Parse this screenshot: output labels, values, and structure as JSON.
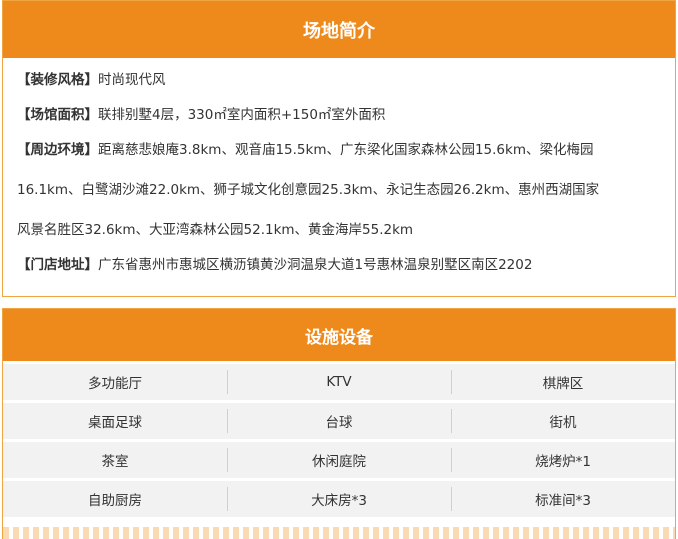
{
  "intro": {
    "title": "场地简介",
    "decor": {
      "label": "【装修风格】",
      "value": "时尚现代风"
    },
    "area": {
      "label": "【场馆面积】",
      "value": "联排别墅4层，330㎡室内面积+150㎡室外面积"
    },
    "env": {
      "label": "【周边环境】",
      "line1": "距离慈悲娘庵3.8km、观音庙15.5km、广东梁化国家森林公园15.6km、梁化梅园",
      "line2": "16.1km、白鹭湖沙滩22.0km、狮子城文化创意园25.3km、永记生态园26.2km、惠州西湖国家",
      "line3": "风景名胜区32.6km、大亚湾森林公园52.1km、黄金海岸55.2km"
    },
    "address": {
      "label": "【门店地址】",
      "value": "广东省惠州市惠城区横沥镇黄沙洞温泉大道1号惠林温泉别墅区南区2202"
    }
  },
  "facilities": {
    "title": "设施设备",
    "rows": [
      [
        "多功能厅",
        "KTV",
        "棋牌区"
      ],
      [
        "桌面足球",
        "台球",
        "街机"
      ],
      [
        "茶室",
        "休闲庭院",
        "烧烤炉*1"
      ],
      [
        "自助厨房",
        "大床房*3",
        "标准间*3"
      ]
    ]
  },
  "colors": {
    "accent": "#ee8a1c",
    "border": "#f0a640",
    "row_bg": "#f2f2f2"
  }
}
